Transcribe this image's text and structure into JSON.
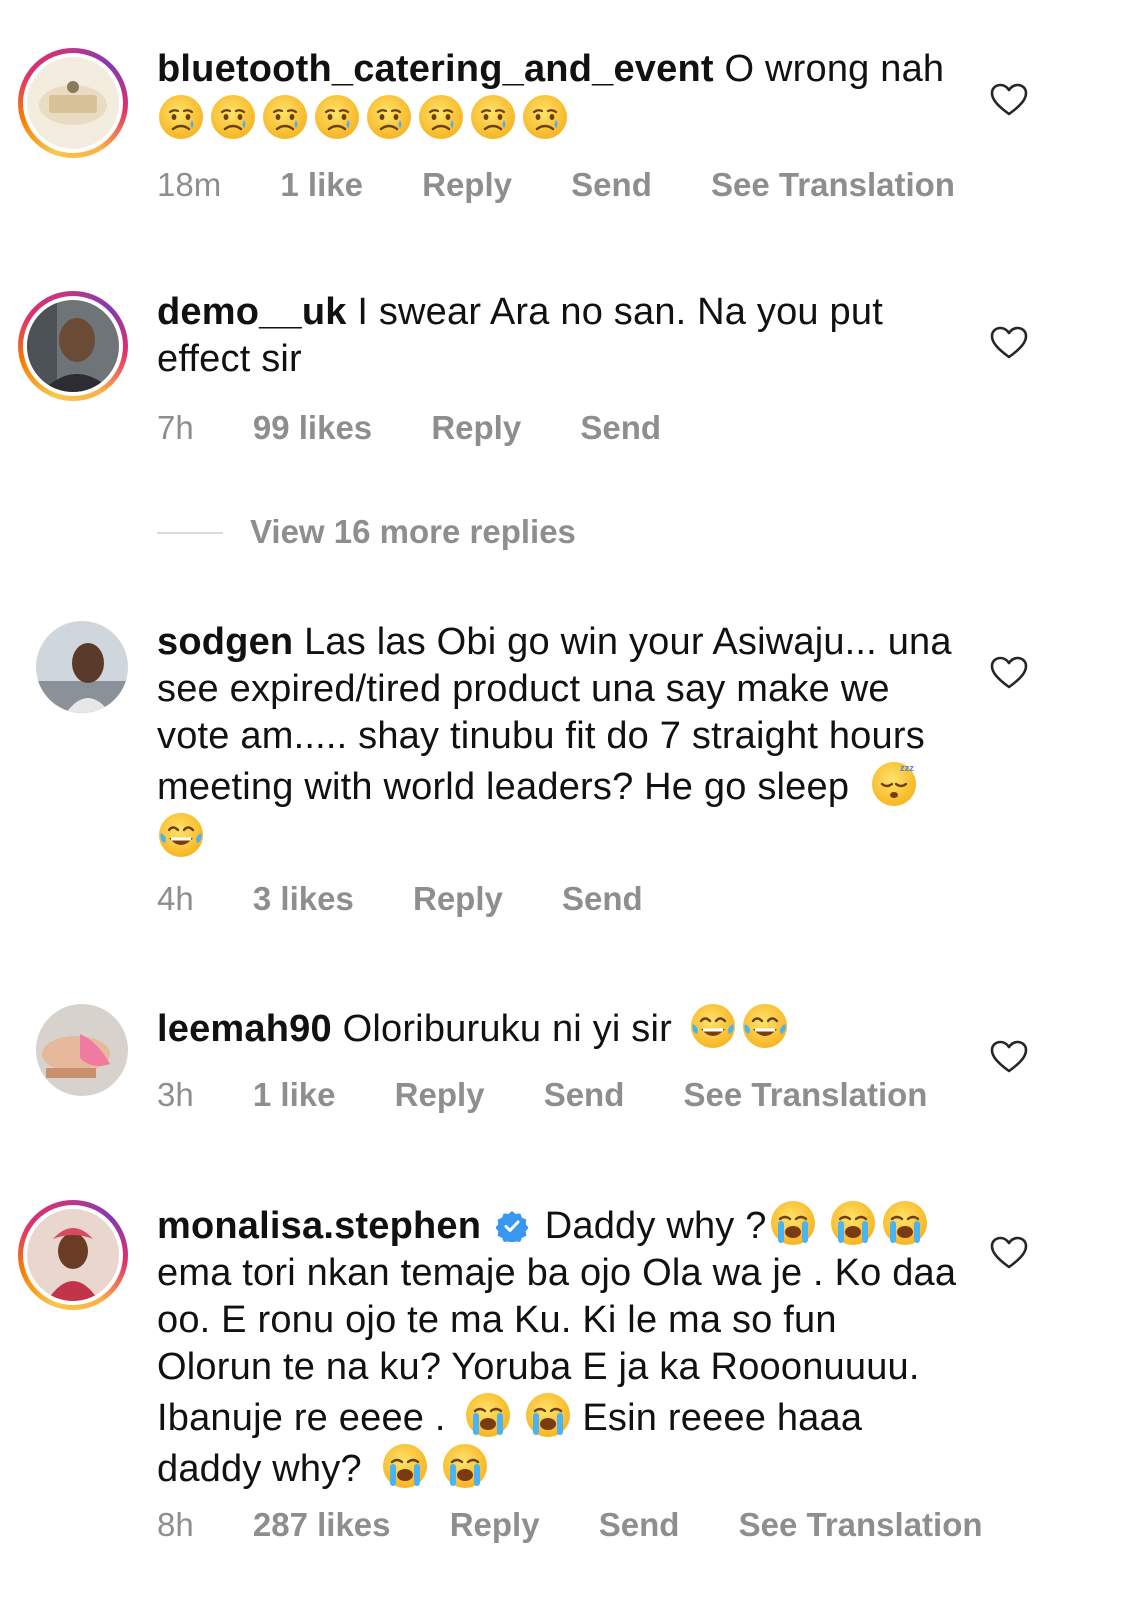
{
  "comments": [
    {
      "username": "bluetooth_catering_and_event",
      "text": "O wrong nah",
      "emojis": [
        "crying-face",
        "crying-face",
        "crying-face",
        "crying-face",
        "crying-face",
        "crying-face",
        "crying-face",
        "crying-face"
      ],
      "time": "18m",
      "likes": "1 like",
      "reply": "Reply",
      "send": "Send",
      "translate": "See Translation"
    },
    {
      "username": "demo__uk",
      "text": "I swear Ara no san. Na you put effect sir",
      "time": "7h",
      "likes": "99 likes",
      "reply": "Reply",
      "send": "Send"
    },
    {
      "username": "sodgen",
      "text": "Las las Obi go win your Asiwaju... una see expired/tired product una say make we vote am..... shay tinubu fit do 7 straight hours meeting with world leaders? He go sleep",
      "emojis": [
        "sleeping-face",
        "tears-of-joy-face"
      ],
      "time": "4h",
      "likes": "3 likes",
      "reply": "Reply",
      "send": "Send"
    },
    {
      "username": "leemah90",
      "text": "Oloriburuku ni yi sir",
      "emojis": [
        "tears-of-joy-face",
        "tears-of-joy-face"
      ],
      "time": "3h",
      "likes": "1 like",
      "reply": "Reply",
      "send": "Send",
      "translate": "See Translation"
    },
    {
      "username": "monalisa.stephen",
      "verified": true,
      "text_parts": [
        "Daddy why ?",
        "ema tori nkan temaje ba ojo Ola wa je . Ko daa oo. E ronu ojo te ma Ku. Ki le ma so fun Olorun te na ku? Yoruba E ja ka Rooonuuuu. Ibanuje re eeee .",
        "Esin reeee haaa daddy why?"
      ],
      "emojis": [
        "loudly-crying-face"
      ],
      "time": "8h",
      "likes": "287 likes",
      "reply": "Reply",
      "send": "Send",
      "translate": "See Translation"
    }
  ],
  "view_replies": "View 16 more replies",
  "icons": {
    "like": "heart-icon",
    "verified": "verified-badge-icon"
  },
  "colors": {
    "meta": "#8e8e8e",
    "verified": "#3897f0"
  }
}
